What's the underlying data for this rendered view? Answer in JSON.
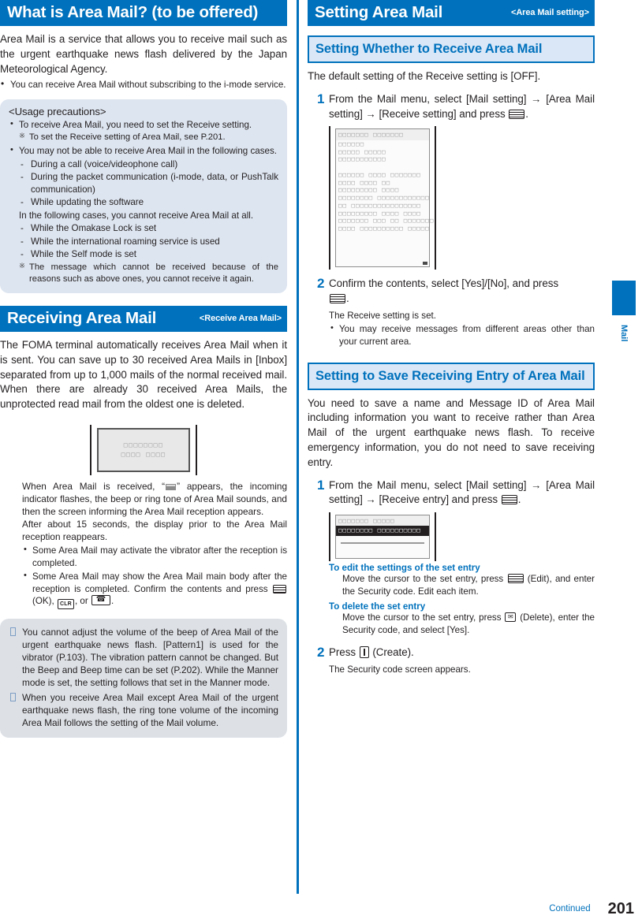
{
  "left": {
    "section1": {
      "title": "What is Area Mail? (to be offered)",
      "intro": "Area Mail is a service that allows you to receive mail such as the urgent earthquake news flash delivered by the Japan Meteorological Agency.",
      "bullets": [
        "You can receive Area Mail without subscribing to the i-mode service."
      ],
      "precautions": {
        "title": "<Usage precautions>",
        "b1": "To receive Area Mail, you need to set the Receive setting.",
        "b1_note": "To set the Receive setting of Area Mail, see P.201.",
        "b2": "You may not be able to receive Area Mail in the following cases.",
        "b2_items": [
          "During a call (voice/videophone call)",
          "During the packet communication (i-mode, data, or PushTalk communication)",
          "While updating the software"
        ],
        "mid": "In the following cases, you cannot receive Area Mail at all.",
        "b3_items": [
          "While the Omakase Lock is set",
          "While the international roaming service is used",
          "While the Self mode is set"
        ],
        "final_note": "The message which cannot be received because of the reasons such as above ones, you cannot receive it again."
      }
    },
    "section2": {
      "title": "Receiving Area Mail",
      "subtitle": "<Receive Area Mail>",
      "intro": "The FOMA terminal automatically receives Area Mail when it is sent. You can save up to 30 received Area Mails in [Inbox] separated from up to 1,000 mails of the normal received mail. When there are already 30 received Area Mails, the unprotected read mail from the oldest one is deleted.",
      "screen": {
        "line1": "□□□□□□□□",
        "line2": "□□□□ □□□□"
      },
      "desc1_pre": "When Area Mail is received, “",
      "desc1_post": "” appears, the incoming indicator flashes, the beep or ring tone of Area Mail sounds, and then the screen informing the Area Mail reception appears.",
      "desc2": "After about 15 seconds, the display prior to the Area Mail reception reappears.",
      "bullet1": "Some Area Mail may activate the vibrator after the reception is completed.",
      "bullet2_pre": "Some Area Mail may show the Area Mail main body after the reception is completed. Confirm the contents and press",
      "bullet2_ok": "(OK),",
      "bullet2_clr": "CLR",
      "bullet2_or": ", or",
      "bullet2_end": ".",
      "notes": [
        "You cannot adjust the volume of the beep of Area Mail of the urgent earthquake news flash. [Pattern1] is used for the vibrator (P.103). The vibration pattern cannot be changed. But the Beep and Beep time can be set (P.202). While the Manner mode is set, the setting follows that set in the Manner mode.",
        "When you receive Area Mail except Area Mail of the urgent earthquake news flash, the ring tone volume of the incoming Area Mail follows the setting of the Mail volume."
      ]
    }
  },
  "right": {
    "section1": {
      "title": "Setting Area Mail",
      "subtitle": "<Area Mail setting>",
      "sub_head": "Setting Whether to Receive Area Mail",
      "intro": "The default setting of the Receive setting is [OFF].",
      "step1": {
        "num": "1",
        "text_a": "From the Mail menu, select [Mail setting] → [Area Mail setting] → [Receive setting] and press",
        "text_b": "."
      },
      "screen1": {
        "title": "□□□□□□□ □□□□□□□",
        "lines": [
          "□□□□□□",
          "□□□□□ □□□□□",
          "□□□□□□□□□□□",
          "",
          "□□□□□□ □□□□ □□□□□□□",
          "□□□□ □□□□ □□",
          "□□□□□□□□□ □□□□",
          "□□□□□□□□ □□□□□□□□□□□□",
          "□□ □□□□□□□□□□□□□□□□",
          "□□□□□□□□□ □□□□ □□□□",
          "□□□□□□□ □□□ □□ □□□□□□□",
          "□□□□ □□□□□□□□□□ □□□□□"
        ]
      },
      "step2": {
        "num": "2",
        "text_a": "Confirm the contents, select [Yes]/[No], and press",
        "text_b": ".",
        "body": "The Receive setting is set.",
        "bullet": "You may receive messages from different areas other than your current area."
      }
    },
    "section2": {
      "sub_head": "Setting to Save Receiving Entry of Area Mail",
      "intro": "You need to save a name and Message ID of Area Mail including information you want to receive rather than Area Mail of the urgent earthquake news flash. To receive emergency information, you do not need to save receiving entry.",
      "step1": {
        "num": "1",
        "text_a": "From the Mail menu, select [Mail setting] → [Area Mail setting] → [Receive entry] and press",
        "text_b": "."
      },
      "screen2": {
        "title": "□□□□□□□ □□□□□",
        "selected": "□□□□□□□□ □□□□□□□□□□"
      },
      "edit_label": "To edit the settings of the set entry",
      "edit_body_a": "Move the cursor to the set entry, press",
      "edit_body_b": "(Edit), and enter the Security code. Edit each item.",
      "delete_label": "To delete the set entry",
      "delete_body_a": "Move the cursor to the set entry, press",
      "delete_body_b": "(Delete), enter the Security code, and select [Yes].",
      "step2": {
        "num": "2",
        "text_a": "Press",
        "text_b": "(Create).",
        "body": "The Security code screen appears."
      }
    }
  },
  "side_tab": {
    "label": "Mail"
  },
  "footer": {
    "continued": "Continued",
    "page": "201"
  },
  "colors": {
    "accent": "#0071bc",
    "sub_head_bg": "#d9e7f7",
    "panel_grey": "#dde1e6",
    "panel_blue": "#dde5f0"
  }
}
